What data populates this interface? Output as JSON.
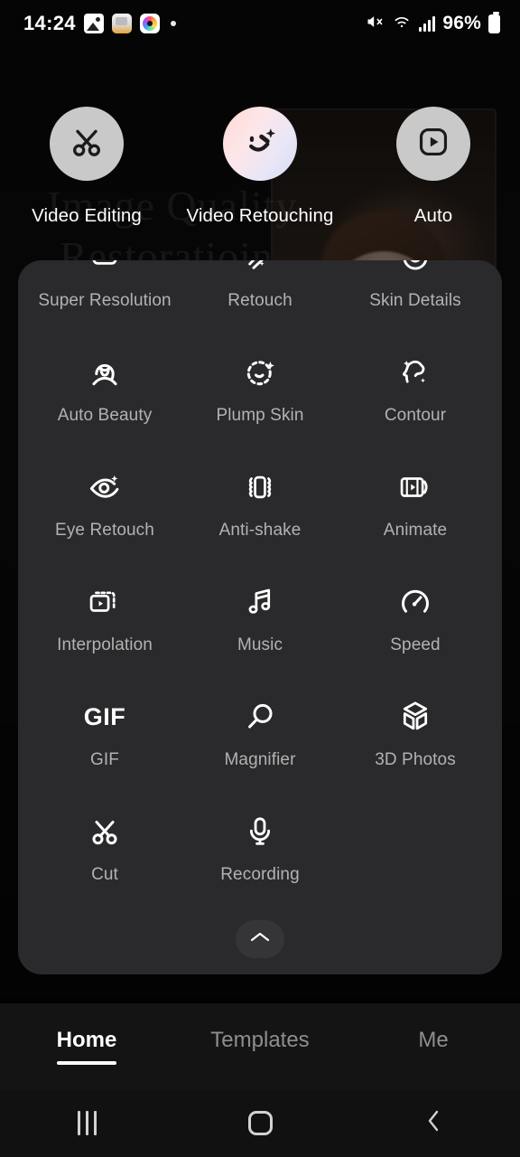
{
  "statusbar": {
    "time": "14:24",
    "icons": [
      "gallery-icon",
      "note-icon",
      "camera-icon",
      "dot-indicator"
    ],
    "mute_icon": "mute-icon",
    "wifi_icon": "wifi-icon",
    "signal_icon": "signal-bars-icon",
    "battery_percent": "96%",
    "battery_icon": "battery-icon"
  },
  "background": {
    "watermark_line1": "Image Quality",
    "watermark_line2": "Restoratioin"
  },
  "shortcuts": [
    {
      "label": "Video Editing",
      "icon": "scissors-icon",
      "style": "plain"
    },
    {
      "label": "Video Retouching",
      "icon": "smiley-sparkle-icon",
      "style": "gradient"
    },
    {
      "label": "Auto",
      "icon": "play-square-icon",
      "style": "plain"
    }
  ],
  "tools": [
    {
      "label": "Super Resolution",
      "icon": "super-resolution-icon"
    },
    {
      "label": "Retouch",
      "icon": "magic-wand-icon"
    },
    {
      "label": "Skin Details",
      "icon": "skin-details-icon"
    },
    {
      "label": "Auto Beauty",
      "icon": "auto-beauty-icon"
    },
    {
      "label": "Plump Skin",
      "icon": "plump-skin-icon"
    },
    {
      "label": "Contour",
      "icon": "contour-icon"
    },
    {
      "label": "Eye Retouch",
      "icon": "eye-retouch-icon"
    },
    {
      "label": "Anti-shake",
      "icon": "anti-shake-icon"
    },
    {
      "label": "Animate",
      "icon": "animate-icon"
    },
    {
      "label": "Interpolation",
      "icon": "interpolation-icon"
    },
    {
      "label": "Music",
      "icon": "music-note-icon"
    },
    {
      "label": "Speed",
      "icon": "speedometer-icon"
    },
    {
      "label": "GIF",
      "icon": "gif-text-icon"
    },
    {
      "label": "Magnifier",
      "icon": "magnifier-icon"
    },
    {
      "label": "3D Photos",
      "icon": "cube-3d-icon"
    },
    {
      "label": "Cut",
      "icon": "scissors-icon"
    },
    {
      "label": "Recording",
      "icon": "microphone-icon"
    }
  ],
  "panel": {
    "collapse_icon": "chevron-up-icon"
  },
  "tabs": [
    {
      "label": "Home",
      "active": true
    },
    {
      "label": "Templates",
      "active": false
    },
    {
      "label": "Me",
      "active": false
    }
  ],
  "navbar": {
    "recents_icon": "recents-icon",
    "home_icon": "home-icon",
    "back_icon": "back-chevron-icon"
  },
  "colors": {
    "panel_bg": "#2a2a2c",
    "page_bg": "#000000",
    "tabbar_bg": "#141414",
    "label_gray": "#b2b2b2",
    "accent_white": "#ffffff"
  }
}
